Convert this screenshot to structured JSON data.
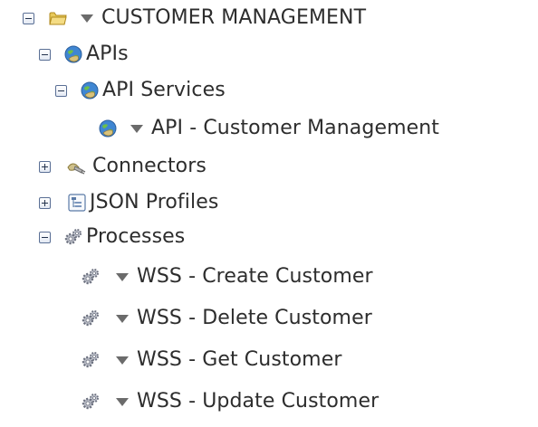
{
  "tree": {
    "root": {
      "label": "CUSTOMER MANAGEMENT",
      "icon": "folder-icon"
    },
    "apis": {
      "label": "APIs",
      "icon": "globe-api-icon"
    },
    "api_services": {
      "label": "API Services",
      "icon": "globe-api-icon"
    },
    "api_customer_management": {
      "label": "API - Customer Management",
      "icon": "globe-api-icon"
    },
    "connectors": {
      "label": "Connectors",
      "icon": "connector-plug-icon"
    },
    "json_profiles": {
      "label": "JSON Profiles",
      "icon": "json-profile-icon"
    },
    "processes": {
      "label": "Processes",
      "icon": "gears-icon"
    },
    "wss_create_customer": {
      "label": "WSS - Create Customer",
      "icon": "gears-icon"
    },
    "wss_delete_customer": {
      "label": "WSS - Delete Customer",
      "icon": "gears-icon"
    },
    "wss_get_customer": {
      "label": "WSS - Get Customer",
      "icon": "gears-icon"
    },
    "wss_update_customer": {
      "label": "WSS - Update Customer",
      "icon": "gears-icon"
    }
  },
  "colors": {
    "folder": "#e8c95a",
    "globe_blue": "#3f86d2",
    "globe_green": "#6cbf4a",
    "text": "#2d2d2d",
    "caret": "#6b6b6b"
  }
}
